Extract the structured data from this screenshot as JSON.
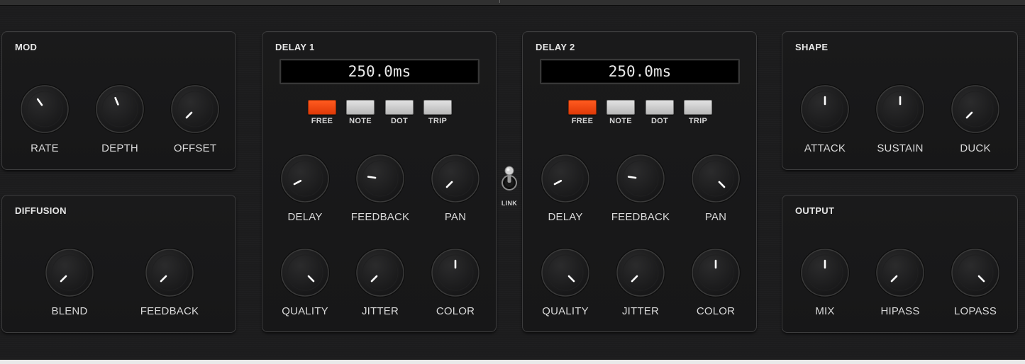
{
  "panels": {
    "mod": {
      "title": "MOD",
      "knobs": [
        {
          "label": "RATE",
          "angle": -35
        },
        {
          "label": "DEPTH",
          "angle": -22
        },
        {
          "label": "OFFSET",
          "angle": -135
        }
      ]
    },
    "diffusion": {
      "title": "DIFFUSION",
      "knobs": [
        {
          "label": "BLEND",
          "angle": -135
        },
        {
          "label": "FEEDBACK",
          "angle": -135
        }
      ]
    },
    "delay1": {
      "title": "DELAY 1",
      "display": "250.0ms",
      "modes": [
        "FREE",
        "NOTE",
        "DOT",
        "TRIP"
      ],
      "active_mode": "FREE",
      "knobs": [
        {
          "label": "DELAY",
          "angle": -118
        },
        {
          "label": "FEEDBACK",
          "angle": -82
        },
        {
          "label": "PAN",
          "angle": -135
        },
        {
          "label": "QUALITY",
          "angle": 135
        },
        {
          "label": "JITTER",
          "angle": -135
        },
        {
          "label": "COLOR",
          "angle": 0
        }
      ]
    },
    "delay2": {
      "title": "DELAY 2",
      "display": "250.0ms",
      "modes": [
        "FREE",
        "NOTE",
        "DOT",
        "TRIP"
      ],
      "active_mode": "FREE",
      "knobs": [
        {
          "label": "DELAY",
          "angle": -118
        },
        {
          "label": "FEEDBACK",
          "angle": -82
        },
        {
          "label": "PAN",
          "angle": 135
        },
        {
          "label": "QUALITY",
          "angle": 135
        },
        {
          "label": "JITTER",
          "angle": -135
        },
        {
          "label": "COLOR",
          "angle": 0
        }
      ]
    },
    "shape": {
      "title": "SHAPE",
      "knobs": [
        {
          "label": "ATTACK",
          "angle": 0
        },
        {
          "label": "SUSTAIN",
          "angle": 0
        },
        {
          "label": "DUCK",
          "angle": -135
        }
      ]
    },
    "output": {
      "title": "OUTPUT",
      "knobs": [
        {
          "label": "MIX",
          "angle": 0
        },
        {
          "label": "HIPASS",
          "angle": -135
        },
        {
          "label": "LOPASS",
          "angle": 135
        }
      ]
    }
  },
  "link": {
    "label": "LINK",
    "state": "up"
  },
  "colors": {
    "active_button": "#f04a12",
    "inactive_button": "#cfcfcf",
    "knob_pointer": "#ffffff",
    "panel_border": "#3c3c3d",
    "lcd_text": "#eaeaea"
  }
}
